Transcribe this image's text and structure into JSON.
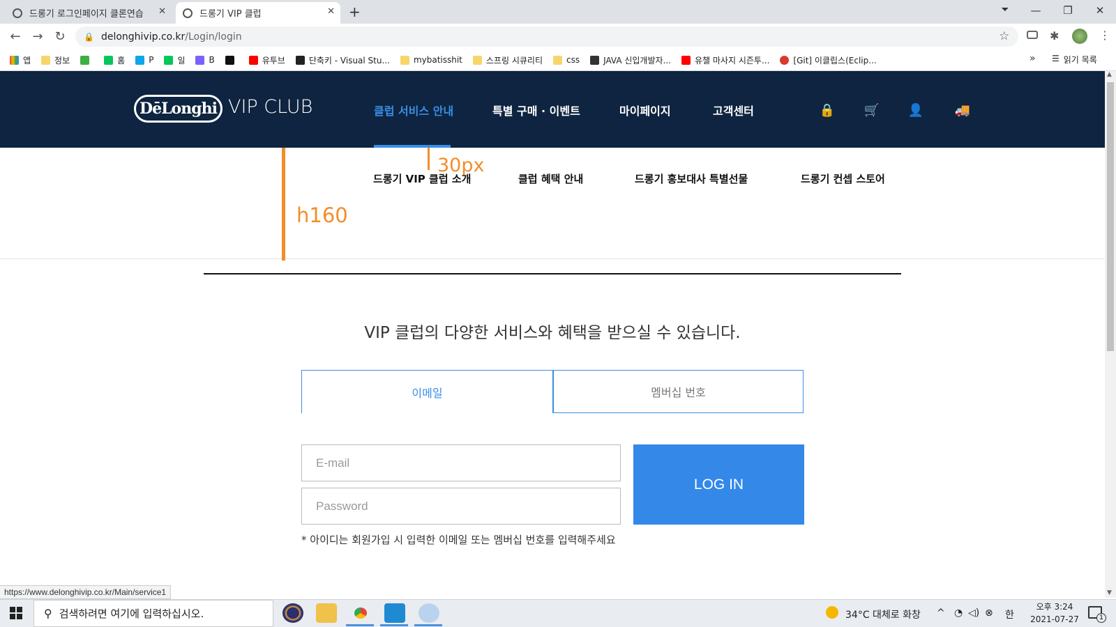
{
  "browser": {
    "tabs": [
      {
        "title": "드롱기 로그인페이지 클론연습"
      },
      {
        "title": "드롱기 VIP 클럽"
      }
    ],
    "new_tab": "+",
    "url_host": "delonghivip.co.kr",
    "url_path": "/Login/login",
    "bookmarks": [
      {
        "label": "앱",
        "color": "#e94335"
      },
      {
        "label": "정보",
        "color": "#f6d66b"
      },
      {
        "label": "",
        "color": "#3cb043"
      },
      {
        "label": "홈",
        "color": "#03c75a"
      },
      {
        "label": "P",
        "color": "#0fa5e9"
      },
      {
        "label": "일",
        "color": "#03c75a"
      },
      {
        "label": "B",
        "color": "#7b61ff"
      },
      {
        "label": "",
        "color": "#111111"
      },
      {
        "label": "유투브",
        "color": "#ff0000"
      },
      {
        "label": "단축키 - Visual Stu...",
        "color": "#222222"
      },
      {
        "label": "mybatisshit",
        "color": "#f6d66b"
      },
      {
        "label": "스프링 시큐리티",
        "color": "#f6d66b"
      },
      {
        "label": "css",
        "color": "#f6d66b"
      },
      {
        "label": "JAVA 신입개발자...",
        "color": "#333333"
      },
      {
        "label": "유챌 마사지 시즌투...",
        "color": "#ff0000"
      },
      {
        "label": "[Git] 이클립스(Eclip...",
        "color": "#d73a2b"
      }
    ],
    "bookmarks_more": "»",
    "reading_list": "읽기 목록",
    "status_url": "https://www.delonghivip.co.kr/Main/service1"
  },
  "site": {
    "logo": "DēLonghi",
    "logo_sub": "VIP CLUB",
    "nav": [
      "클럽 서비스 안내",
      "특별 구매 · 이벤트",
      "마이페이지",
      "고객센터"
    ],
    "submenu": [
      "드롱기 VIP 클럽 소개",
      "클럽 혜택 안내",
      "드롱기 홍보대사 특별선물",
      "드롱기 컨셉 스토어"
    ],
    "annotation_30": "30px",
    "annotation_h160": "h160",
    "tagline": "VIP 클럽의 다양한 서비스와 혜택을 받으실 수 있습니다.",
    "login_tabs": [
      "이메일",
      "멤버십 번호"
    ],
    "email_placeholder": "E-mail",
    "password_placeholder": "Password",
    "login_button": "LOG IN",
    "helper": "* 아이디는 회원가입 시 입력한 이메일 또는 멤버십 번호를 입력해주세요",
    "accent": "#3388e8",
    "header_bg": "#0e2440"
  },
  "taskbar": {
    "search_placeholder": "검색하려면 여기에 입력하십시오.",
    "weather": "34°C  대체로 화창",
    "ime": "한",
    "time": "오후 3:24",
    "date": "2021-07-27",
    "notification_count": "1"
  }
}
